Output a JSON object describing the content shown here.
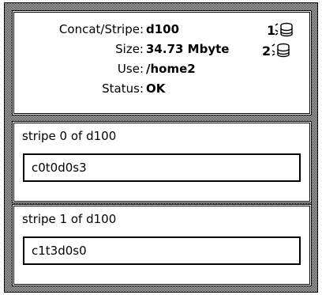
{
  "info": {
    "concat_label": "Concat/Stripe:",
    "concat_value": "d100",
    "size_label": "Size:",
    "size_value": "34.73 Mbyte",
    "use_label": "Use:",
    "use_value": "/home2",
    "status_label": "Status:",
    "status_value": "OK",
    "icons": [
      {
        "name": "stripe-1-disk-icon",
        "label": "1"
      },
      {
        "name": "stripe-2-disk-icon",
        "label": "2"
      }
    ]
  },
  "stripes": [
    {
      "title": "stripe 0 of d100",
      "slice": "c0t0d0s3"
    },
    {
      "title": "stripe 1 of d100",
      "slice": "c1t3d0s0"
    }
  ]
}
